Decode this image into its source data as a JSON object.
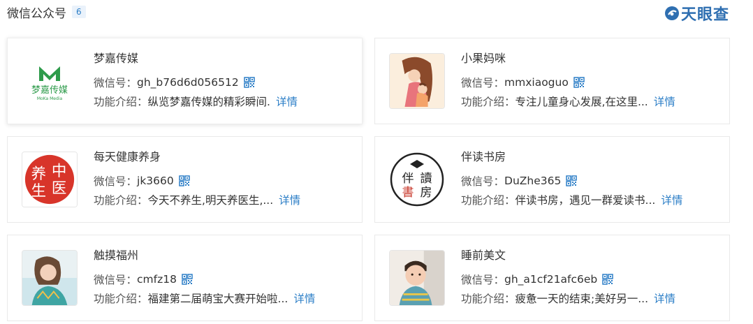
{
  "header": {
    "title": "微信公众号",
    "count": "6"
  },
  "brand": {
    "name": "天眼查",
    "accent": "#2f6fb1"
  },
  "labels": {
    "wechat_id": "微信号：",
    "intro": "功能介绍：",
    "more": "详情"
  },
  "accounts": [
    {
      "name": "梦嘉传媒",
      "wechat_id": "gh_b76d6d056512",
      "intro": "纵览梦嘉传媒的精彩瞬间.",
      "avatar_icon": "moka-media-logo",
      "avatar_text": "梦嘉传媒",
      "avatar_subtext": "MoKa Media"
    },
    {
      "name": "小果妈咪",
      "wechat_id": "mmxiaoguo",
      "intro": "专注儿童身心发展,在这里...",
      "avatar_icon": "mother-child-illustration"
    },
    {
      "name": "每天健康养身",
      "wechat_id": "jk3660",
      "intro": "今天不养生,明天养医生,...",
      "avatar_icon": "health-seal-logo",
      "avatar_text": [
        "养",
        "中",
        "生",
        "医"
      ]
    },
    {
      "name": "伴读书房",
      "wechat_id": "DuZhe365",
      "intro": "伴读书房，遇见一群爱读书...",
      "avatar_icon": "book-house-logo",
      "avatar_text": [
        "伴",
        "讀",
        "書",
        "房"
      ]
    },
    {
      "name": "触摸福州",
      "wechat_id": "cmfz18",
      "intro": "福建第二届萌宝大赛开始啦...",
      "avatar_icon": "woman-portrait-photo"
    },
    {
      "name": "睡前美文",
      "wechat_id": "gh_a1cf21afc6eb",
      "intro": "疲惫一天的结束;美好另一...",
      "avatar_icon": "child-portrait-photo"
    }
  ]
}
